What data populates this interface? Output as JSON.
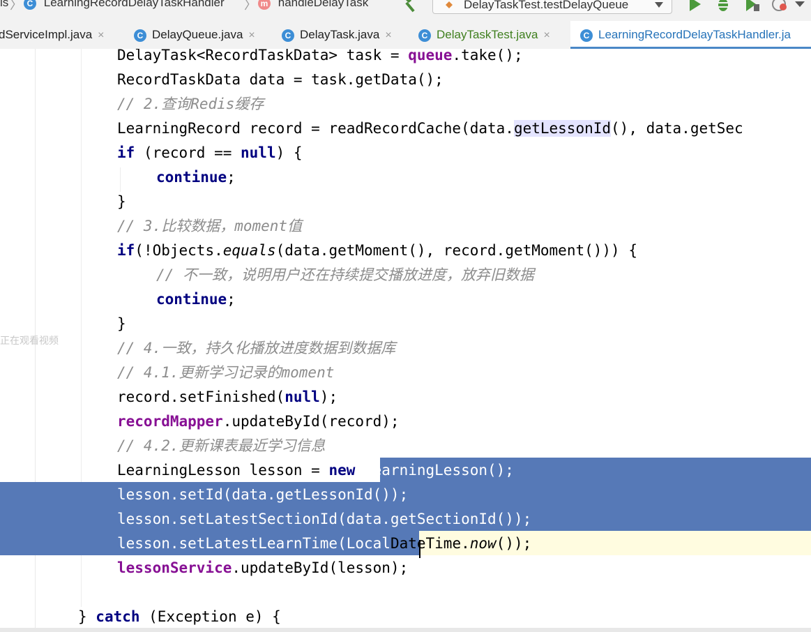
{
  "navbar": {
    "crumb_prefix": "is",
    "crumb_class": "LearningRecordDelayTaskHandler",
    "crumb_method": "handleDelayTask",
    "run_config": "DelayTaskTest.testDelayQueue"
  },
  "tabs": [
    {
      "label": "dServiceImpl.java",
      "close": "×"
    },
    {
      "label": "DelayQueue.java",
      "close": "×"
    },
    {
      "label": "DelayTask.java",
      "close": "×"
    },
    {
      "label": "DelayTaskTest.java",
      "close": "×"
    },
    {
      "label": "LearningRecordDelayTaskHandler.ja"
    }
  ],
  "side_caption": "正在观看视频",
  "code": {
    "l1": {
      "type": "DelayTask<RecordTaskData> task = ",
      "field": "queue",
      "rest": ".take();"
    },
    "l2": "RecordTaskData data = task.getData();",
    "l3": "// 2.查询Redis缓存",
    "l4": {
      "pre": "LearningRecord record = readRecordCache(data.",
      "hl": "getLessonId",
      "post": "(), data.getSec"
    },
    "l5": {
      "kw": "if",
      "mid": " (record == ",
      "kw2": "null",
      "post": ") {"
    },
    "l6": {
      "kw": "continue",
      "post": ";"
    },
    "l7": "}",
    "l8": "// 3.比较数据，moment值",
    "l9": {
      "kw": "if",
      "pre": "(!Objects.",
      "ital": "equals",
      "post": "(data.getMoment(), record.getMoment())) {"
    },
    "l10": "// 不一致，说明用户还在持续提交播放进度，放弃旧数据",
    "l11": {
      "kw": "continue",
      "post": ";"
    },
    "l12": "}",
    "l13": "// 4.一致，持久化播放进度数据到数据库",
    "l14": "// 4.1.更新学习记录的moment",
    "l15": {
      "pre": "record.setFinished(",
      "kw": "null",
      "post": ");"
    },
    "l16": {
      "field": "recordMapper",
      "post": ".updateById(record);"
    },
    "l17": "// 4.2.更新课表最近学习信息",
    "l18": {
      "pre": "LearningLesson lesson = ",
      "kw": "new",
      "sel": " LearningLesson();"
    },
    "l19": "lesson.setId(data.getLessonId());",
    "l20": "lesson.setLatestSectionId(data.getSectionId());",
    "l21": {
      "sel": "lesson.setLatestLearnTime(Local",
      "post": "DateTime.",
      "ital": "now",
      "post2": "());"
    },
    "l22": {
      "field": "lessonService",
      "post": ".updateById(lesson);"
    },
    "l24": {
      "pre": "} ",
      "kw": "catch",
      "post": " (Exception e) {"
    }
  }
}
